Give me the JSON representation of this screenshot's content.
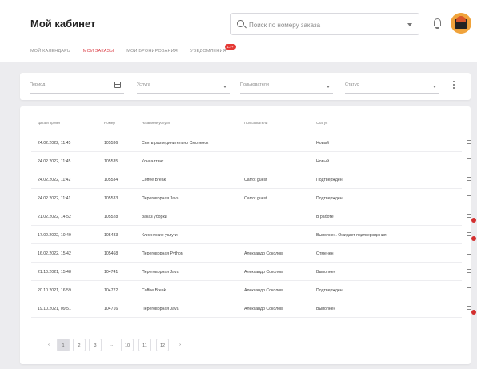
{
  "header": {
    "title": "Мой кабинет",
    "search": {
      "placeholder": "Поиск по номеру заказа"
    },
    "icons": {
      "search": "search-icon",
      "bell": "bell-icon",
      "avatar": "avatar"
    }
  },
  "tabs": [
    {
      "label": "Мой календарь"
    },
    {
      "label": "Мои заказы",
      "active": true
    },
    {
      "label": "Мои бронирования"
    },
    {
      "label": "Уведомления",
      "badge": "12+"
    }
  ],
  "filters": {
    "period": "Период",
    "service": "Услуга",
    "user": "Пользователи",
    "status": "Статус"
  },
  "table": {
    "columns": [
      "Дата и время",
      "Номер",
      "Название услуги",
      "Пользователи",
      "Статус"
    ],
    "rows": [
      {
        "datetime": "24.02.2022, 11:45",
        "number": "105536",
        "service": "Снять разъединительно Смоленск",
        "user": "",
        "status": "Новый",
        "unread": false
      },
      {
        "datetime": "24.02.2022, 11:45",
        "number": "105535",
        "service": "Консалтинг",
        "user": "",
        "status": "Новый",
        "unread": false
      },
      {
        "datetime": "24.02.2022, 11:42",
        "number": "105534",
        "service": "Coffee Break",
        "user": "Carrot guest",
        "status": "Подтвержден",
        "unread": false
      },
      {
        "datetime": "24.02.2022, 11:41",
        "number": "105533",
        "service": "Переговорная Java",
        "user": "Carrot guest",
        "status": "Подтвержден",
        "unread": false
      },
      {
        "datetime": "21.02.2022, 14:52",
        "number": "105528",
        "service": "Заказ уборки",
        "user": "",
        "status": "В работе",
        "unread": true
      },
      {
        "datetime": "17.02.2022, 10:49",
        "number": "105483",
        "service": "Клиентские услуги",
        "user": "",
        "status": "Выполнен. Ожидает подтверждения",
        "unread": true
      },
      {
        "datetime": "16.02.2022, 15:42",
        "number": "105468",
        "service": "Переговорная Python",
        "user": "Александр Соколов",
        "status": "Отменен",
        "unread": false
      },
      {
        "datetime": "21.10.2021, 15:48",
        "number": "104741",
        "service": "Переговорная Java",
        "user": "Александр Соколов",
        "status": "Выполнен",
        "unread": false
      },
      {
        "datetime": "20.10.2021, 16:59",
        "number": "104722",
        "service": "Coffee Break",
        "user": "Александр Соколов",
        "status": "Подтвержден",
        "unread": false
      },
      {
        "datetime": "19.10.2021, 09:51",
        "number": "104716",
        "service": "Переговорная Java",
        "user": "Александр Соколов",
        "status": "Выполнен",
        "unread": true
      }
    ]
  },
  "pagination": {
    "prev": "‹",
    "next": "›",
    "pages": [
      "1",
      "2",
      "3",
      "...",
      "10",
      "11",
      "12"
    ],
    "current": "1"
  },
  "colors": {
    "accent": "#d9363e",
    "badge": "#e53935",
    "unread": "#d32f2f"
  }
}
